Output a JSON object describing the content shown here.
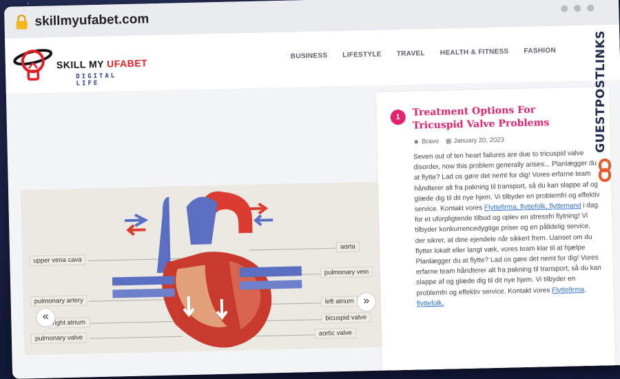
{
  "browser": {
    "url": "skillmyufabet.com"
  },
  "site": {
    "logo_name": "SKILL MY ",
    "logo_name_accent": "UFABET",
    "logo_tagline": "DIGITAL LIFE",
    "nav": [
      "BUSINESS",
      "LIFESTYLE",
      "TRAVEL",
      "HEALTH & FITNESS",
      "FASHION"
    ]
  },
  "featured_image": {
    "labels_left": [
      "upper vena cava",
      "pulmonary artery",
      "right atrium",
      "pulmonary valve"
    ],
    "labels_right": [
      "aorta",
      "pulmonary vein",
      "left atrium",
      "bicuspid valve",
      "aortic valve"
    ],
    "prev_label": "«",
    "next_label": "»"
  },
  "sidebar": {
    "post_number": "1",
    "post_title": "Treatment Options For Tricuspid Valve Problems",
    "author": "Bravo",
    "date": "January 20, 2023",
    "excerpt_1": "Seven out of ten heart failures are due to tricuspid valve disorder, now this problem generally arises... Planlægger du at flytte? Lad os gøre det nemt for dig! Vores erfarne team håndterer alt fra pakning til transport, så du kan slappe af og glæde dig til dit nye hjem. Vi tilbyder en problemfri og effektiv service. Kontakt vores ",
    "link_1": "Flyttefirma, flyttefolk, flyttemand",
    "excerpt_2": " i dag for et uforpligtende tilbud og oplev en stressfri flytning! Vi tilbyder konkurrencedygtige priser og en pålidelig service, der sikrer, at dine ejendele når sikkert frem. Uanset om du flytter lokalt eller langt væk, vores team klar til at hjælpe",
    "excerpt_3": "Planlægger du at flytte? Lad os gøre det nemt for dig! Vores erfarne team håndterer alt fra pakning til transport, så du kan slappe af og glæde dig til dit nye hjem. Vi tilbyder en problemfri og effektiv service. Kontakt vores ",
    "link_2": "Flyttefirma, flyttefolk,"
  },
  "badge": {
    "text_main": "GUESTPOSTLINKS",
    "brand_color": "#e65c2c"
  },
  "colors": {
    "accent": "#e3216f",
    "link": "#2f6fd6",
    "logo_red": "#e51c23",
    "logo_blue": "#2b3a8a"
  }
}
